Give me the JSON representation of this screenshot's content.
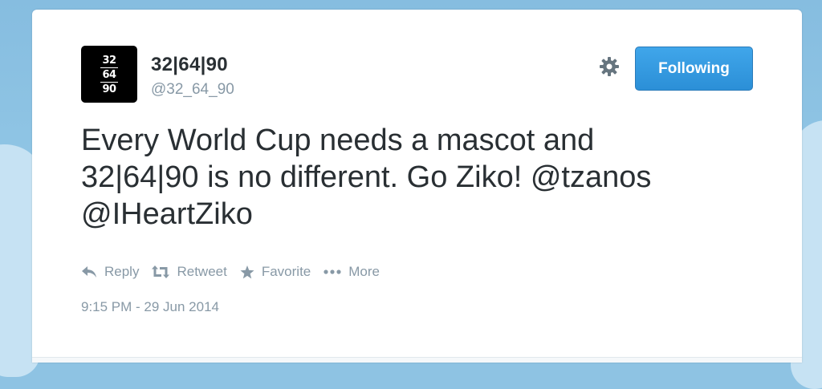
{
  "user": {
    "avatar_lines": [
      "32",
      "64",
      "90"
    ],
    "display_name": "32|64|90",
    "handle": "@32_64_90"
  },
  "header": {
    "follow_label": "Following"
  },
  "tweet": {
    "text_line1": "Every World Cup needs a mascot and",
    "text_line2": "32|64|90 is no different. Go Ziko! ",
    "mention1": "@tzanos",
    "mention2": "@IHeartZiko",
    "timestamp": "9:15 PM - 29 Jun 2014"
  },
  "actions": {
    "reply": "Reply",
    "retweet": "Retweet",
    "favorite": "Favorite",
    "more": "More"
  },
  "icons": {
    "settings": "gear-icon",
    "reply": "reply-icon",
    "retweet": "retweet-icon",
    "favorite": "star-icon",
    "more": "ellipsis-icon"
  },
  "colors": {
    "background": "#8ec3e3",
    "follow_button": "#2b8fd7",
    "text": "#292f33",
    "muted": "#8899a6"
  }
}
